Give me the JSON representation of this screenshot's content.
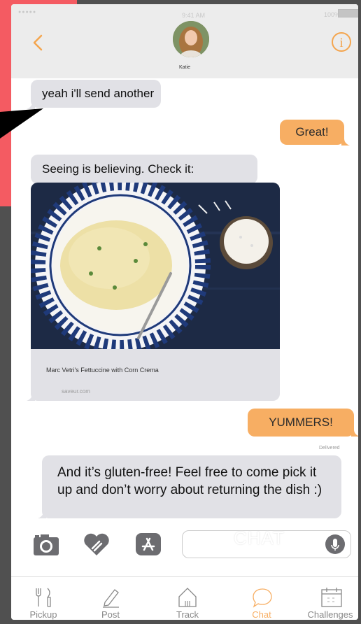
{
  "status": {
    "signal": "●●●●●",
    "time": "9:41 AM",
    "battery": "100%"
  },
  "header": {
    "contact_name": "Katie",
    "info_label": "i"
  },
  "messages": [
    {
      "direction": "in",
      "text": "yeah i'll send another"
    },
    {
      "direction": "out",
      "text": "Great!"
    },
    {
      "direction": "in",
      "text": "Seeing is believing. Check it:"
    },
    {
      "direction": "out",
      "text": "YUMMERS!"
    },
    {
      "direction": "in",
      "text": "And it’s gluten-free! Feel free to come pick it up and don’t worry about returning the dish :)"
    }
  ],
  "link_preview": {
    "title": "Marc Vetri's Fettuccine with Corn Crema",
    "domain": "saveur.com"
  },
  "delivery_status": "Delivered",
  "compose": {
    "watermark": "CHAT"
  },
  "tabs": [
    {
      "label": "Pickup",
      "icon": "utensils-icon"
    },
    {
      "label": "Post",
      "icon": "pencil-icon"
    },
    {
      "label": "Track",
      "icon": "house-icon"
    },
    {
      "label": "Chat",
      "icon": "chat-bubble-icon",
      "active": true
    },
    {
      "label": "Challenges",
      "icon": "calendar-icon"
    }
  ],
  "colors": {
    "accent": "#f7ae63",
    "incoming_bubble": "#e1e1e6",
    "backdrop_red": "#f45b62"
  }
}
